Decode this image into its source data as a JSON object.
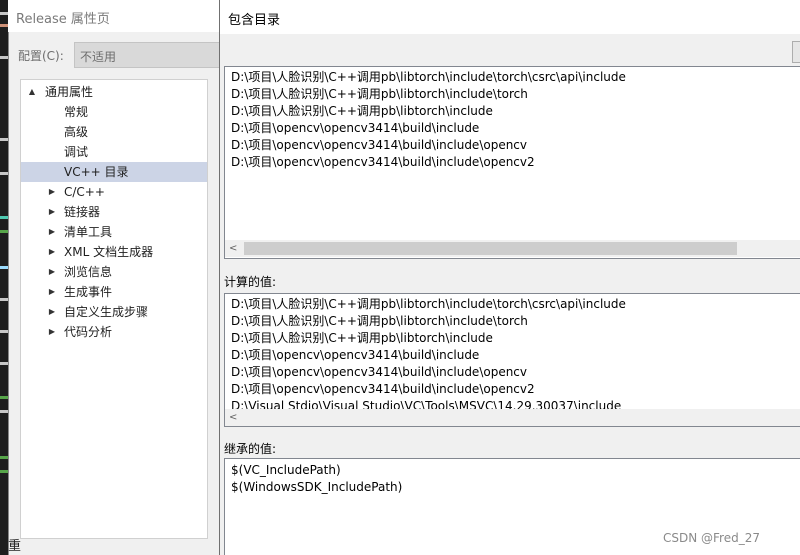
{
  "back_dialog": {
    "title": "Release 属性页",
    "config_label": "配置(C):",
    "config_value": "不适用",
    "tree": [
      {
        "label": "通用属性",
        "caret": "▲",
        "selected": false
      },
      {
        "label": "常规",
        "caret": "",
        "selected": false
      },
      {
        "label": "高级",
        "caret": "",
        "selected": false
      },
      {
        "label": "调试",
        "caret": "",
        "selected": false
      },
      {
        "label": "VC++ 目录",
        "caret": "",
        "selected": true
      },
      {
        "label": "C/C++",
        "caret": "▶",
        "selected": false
      },
      {
        "label": "链接器",
        "caret": "▶",
        "selected": false
      },
      {
        "label": "清单工具",
        "caret": "▶",
        "selected": false
      },
      {
        "label": "XML 文档生成器",
        "caret": "▶",
        "selected": false
      },
      {
        "label": "浏览信息",
        "caret": "▶",
        "selected": false
      },
      {
        "label": "生成事件",
        "caret": "▶",
        "selected": false
      },
      {
        "label": "自定义生成步骤",
        "caret": "▶",
        "selected": false
      },
      {
        "label": "代码分析",
        "caret": "▶",
        "selected": false
      }
    ],
    "bottom_char": "重"
  },
  "main_dialog": {
    "title": "包含目录",
    "include_paths": [
      "D:\\项目\\人脸识别\\C++调用pb\\libtorch\\include\\torch\\csrc\\api\\include",
      "D:\\项目\\人脸识别\\C++调用pb\\libtorch\\include\\torch",
      "D:\\项目\\人脸识别\\C++调用pb\\libtorch\\include",
      "D:\\项目\\opencv\\opencv3414\\build\\include",
      "D:\\项目\\opencv\\opencv3414\\build\\include\\opencv",
      "D:\\项目\\opencv\\opencv3414\\build\\include\\opencv2"
    ],
    "computed_label": "计算的值:",
    "computed_values": [
      "D:\\项目\\人脸识别\\C++调用pb\\libtorch\\include\\torch\\csrc\\api\\include",
      "D:\\项目\\人脸识别\\C++调用pb\\libtorch\\include\\torch",
      "D:\\项目\\人脸识别\\C++调用pb\\libtorch\\include",
      "D:\\项目\\opencv\\opencv3414\\build\\include",
      "D:\\项目\\opencv\\opencv3414\\build\\include\\opencv",
      "D:\\项目\\opencv\\opencv3414\\build\\include\\opencv2",
      "D:\\Visual Stdio\\Visual Studio\\VC\\Tools\\MSVC\\14.29.30037\\include"
    ],
    "inherited_label": "继承的值:",
    "inherited_values": [
      "$(VC_IncludePath)",
      "$(WindowsSDK_IncludePath)"
    ],
    "scroll_left_glyph": "<"
  },
  "watermark": "CSDN @Fred_27",
  "colors": {
    "selection": "#ccd4e6",
    "scroll_thumb": "#cdcdcd",
    "editor_bg": "#1e1e1e"
  }
}
